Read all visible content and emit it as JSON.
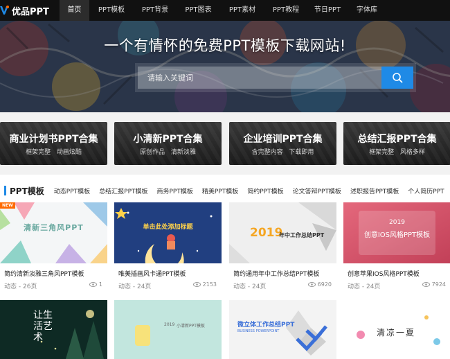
{
  "nav": {
    "logo": "优品PPT",
    "items": [
      "首页",
      "PPT模板",
      "PPT背景",
      "PPT图表",
      "PPT素材",
      "PPT教程",
      "节日PPT",
      "字体库"
    ]
  },
  "hero": {
    "title": "一个有情怀的免费PPT模板下载网站!",
    "search_placeholder": "请输入关键词",
    "search_icon": "search-icon"
  },
  "categories": [
    {
      "title": "商业计划书PPT合集",
      "sub": "框架完整 动画炫酷"
    },
    {
      "title": "小清新PPT合集",
      "sub": "原创作品 清新淡雅"
    },
    {
      "title": "企业培训PPT合集",
      "sub": "含完整内容 下载即用"
    },
    {
      "title": "总结汇报PPT合集",
      "sub": "框架完整 风格多样"
    }
  ],
  "section": {
    "heading": "PPT模板",
    "tabs": [
      "动态PPT模板",
      "总结汇报PPT模板",
      "商务PPT模板",
      "精美PPT模板",
      "简约PPT模板",
      "论文答辩PPT模板",
      "述职报告PPT模板",
      "个人简历PPT"
    ]
  },
  "cards": [
    {
      "title": "简约清新淡雅三角风PPT模板",
      "meta": "动态 - 26页",
      "views": "1",
      "badge": "NEW",
      "thumb_text": "清新三角风PPT"
    },
    {
      "title": "唯美插画风卡通PPT模板",
      "meta": "动态 - 24页",
      "views": "2153",
      "thumb_text": "单击此处添加标题"
    },
    {
      "title": "简约通用年中工作总结PPT模板",
      "meta": "动态 - 24页",
      "views": "6920",
      "thumb_year": "2019",
      "thumb_text": "年中工作总结PPT"
    },
    {
      "title": "创意苹果IOS风格PPT模板",
      "meta": "动态 - 24页",
      "views": "7924",
      "thumb_year": "2019",
      "thumb_text": "创意IOS风格PPT模板"
    }
  ],
  "cards_row2": [
    {
      "thumb_text": "让生活艺术"
    },
    {
      "thumb_year": "2019",
      "thumb_text": "小清新PPT模板"
    },
    {
      "thumb_text": "微立体工作总结PPT",
      "thumb_sub": "BUSINESS POWERPOINT"
    },
    {
      "thumb_text": "清凉一夏"
    }
  ],
  "colors": {
    "accent": "#1f8ae6",
    "nav_bg": "#111111",
    "new_badge": "#ff6a00"
  }
}
